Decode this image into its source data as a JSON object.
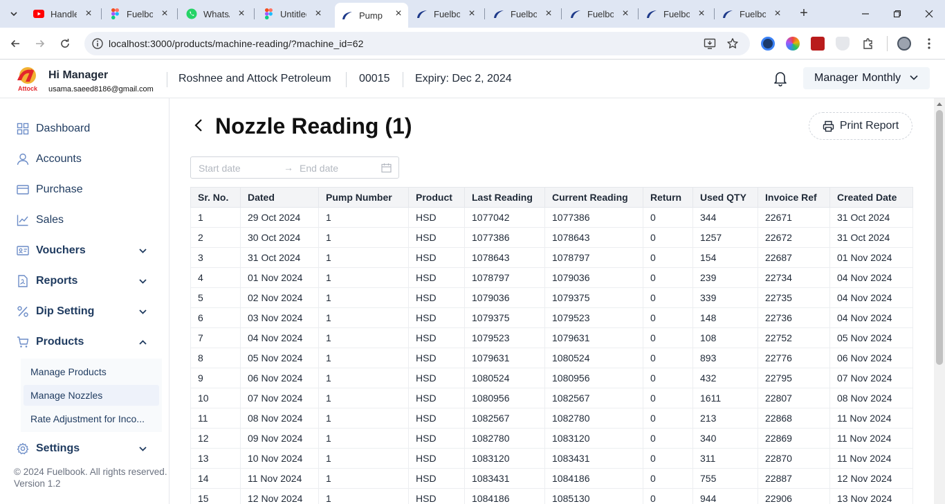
{
  "browser": {
    "tabs": [
      {
        "title": "Handle",
        "icon": "youtube-icon",
        "active": false
      },
      {
        "title": "Fuelboo",
        "icon": "figma-icon",
        "active": false
      },
      {
        "title": "WhatsA",
        "icon": "whatsapp-icon",
        "active": false
      },
      {
        "title": "Untitled",
        "icon": "figma-icon",
        "active": false
      },
      {
        "title": "Pump R",
        "icon": "fuelbook-icon",
        "active": true
      },
      {
        "title": "Fuelboo",
        "icon": "fuelbook-icon",
        "active": false
      },
      {
        "title": "Fuelboo",
        "icon": "fuelbook-icon",
        "active": false
      },
      {
        "title": "Fuelboo",
        "icon": "fuelbook-icon",
        "active": false
      },
      {
        "title": "Fuelboo",
        "icon": "fuelbook-icon",
        "active": false
      },
      {
        "title": "Fuelboo",
        "icon": "fuelbook-icon",
        "active": false
      }
    ],
    "url": "localhost:3000/products/machine-reading/?machine_id=62"
  },
  "header": {
    "logo_text": "Attock",
    "greeting": "Hi Manager",
    "email": "usama.saeed8186@gmail.com",
    "company": "Roshnee and Attock Petroleum",
    "code": "00015",
    "expiry": "Expiry: Dec 2, 2024",
    "role": "Manager",
    "plan": "Monthly"
  },
  "sidebar": {
    "items": [
      {
        "label": "Dashboard",
        "icon": "grid-icon",
        "bold": false,
        "chevron": ""
      },
      {
        "label": "Accounts",
        "icon": "user-icon",
        "bold": false,
        "chevron": ""
      },
      {
        "label": "Purchase",
        "icon": "card-icon",
        "bold": false,
        "chevron": ""
      },
      {
        "label": "Sales",
        "icon": "chart-line-icon",
        "bold": false,
        "chevron": ""
      },
      {
        "label": "Vouchers",
        "icon": "voucher-icon",
        "bold": true,
        "chevron": "down"
      },
      {
        "label": "Reports",
        "icon": "report-icon",
        "bold": true,
        "chevron": "down"
      },
      {
        "label": "Dip Setting",
        "icon": "percent-icon",
        "bold": true,
        "chevron": "down"
      },
      {
        "label": "Products",
        "icon": "cart-icon",
        "bold": true,
        "chevron": "up"
      }
    ],
    "subitems": [
      {
        "label": "Manage Products",
        "selected": false
      },
      {
        "label": "Manage Nozzles",
        "selected": true
      },
      {
        "label": "Rate Adjustment for Inco...",
        "selected": false
      }
    ],
    "settings": {
      "label": "Settings",
      "icon": "gear-icon"
    },
    "copyright": "© 2024 Fuelbook. All rights reserved.",
    "version": "Version 1.2"
  },
  "main": {
    "title": "Nozzle Reading (1)",
    "print_label": "Print Report",
    "start_placeholder": "Start date",
    "end_placeholder": "End date",
    "table": {
      "columns": [
        "Sr. No.",
        "Dated",
        "Pump Number",
        "Product",
        "Last Reading",
        "Current Reading",
        "Return",
        "Used QTY",
        "Invoice Ref",
        "Created Date"
      ],
      "rows": [
        [
          "1",
          "29 Oct 2024",
          "1",
          "HSD",
          "1077042",
          "1077386",
          "0",
          "344",
          "22671",
          "31 Oct 2024"
        ],
        [
          "2",
          "30 Oct 2024",
          "1",
          "HSD",
          "1077386",
          "1078643",
          "0",
          "1257",
          "22672",
          "31 Oct 2024"
        ],
        [
          "3",
          "31 Oct 2024",
          "1",
          "HSD",
          "1078643",
          "1078797",
          "0",
          "154",
          "22687",
          "01 Nov 2024"
        ],
        [
          "4",
          "01 Nov 2024",
          "1",
          "HSD",
          "1078797",
          "1079036",
          "0",
          "239",
          "22734",
          "04 Nov 2024"
        ],
        [
          "5",
          "02 Nov 2024",
          "1",
          "HSD",
          "1079036",
          "1079375",
          "0",
          "339",
          "22735",
          "04 Nov 2024"
        ],
        [
          "6",
          "03 Nov 2024",
          "1",
          "HSD",
          "1079375",
          "1079523",
          "0",
          "148",
          "22736",
          "04 Nov 2024"
        ],
        [
          "7",
          "04 Nov 2024",
          "1",
          "HSD",
          "1079523",
          "1079631",
          "0",
          "108",
          "22752",
          "05 Nov 2024"
        ],
        [
          "8",
          "05 Nov 2024",
          "1",
          "HSD",
          "1079631",
          "1080524",
          "0",
          "893",
          "22776",
          "06 Nov 2024"
        ],
        [
          "9",
          "06 Nov 2024",
          "1",
          "HSD",
          "1080524",
          "1080956",
          "0",
          "432",
          "22795",
          "07 Nov 2024"
        ],
        [
          "10",
          "07 Nov 2024",
          "1",
          "HSD",
          "1080956",
          "1082567",
          "0",
          "1611",
          "22807",
          "08 Nov 2024"
        ],
        [
          "11",
          "08 Nov 2024",
          "1",
          "HSD",
          "1082567",
          "1082780",
          "0",
          "213",
          "22868",
          "11 Nov 2024"
        ],
        [
          "12",
          "09 Nov 2024",
          "1",
          "HSD",
          "1082780",
          "1083120",
          "0",
          "340",
          "22869",
          "11 Nov 2024"
        ],
        [
          "13",
          "10 Nov 2024",
          "1",
          "HSD",
          "1083120",
          "1083431",
          "0",
          "311",
          "22870",
          "11 Nov 2024"
        ],
        [
          "14",
          "11 Nov 2024",
          "1",
          "HSD",
          "1083431",
          "1084186",
          "0",
          "755",
          "22887",
          "12 Nov 2024"
        ],
        [
          "15",
          "12 Nov 2024",
          "1",
          "HSD",
          "1084186",
          "1085130",
          "0",
          "944",
          "22906",
          "13 Nov 2024"
        ]
      ]
    }
  },
  "colors": {
    "sidebar_text": "#1e3a5f",
    "tabbar_bg": "#dfe6f3",
    "logo_red": "#e3262b"
  }
}
